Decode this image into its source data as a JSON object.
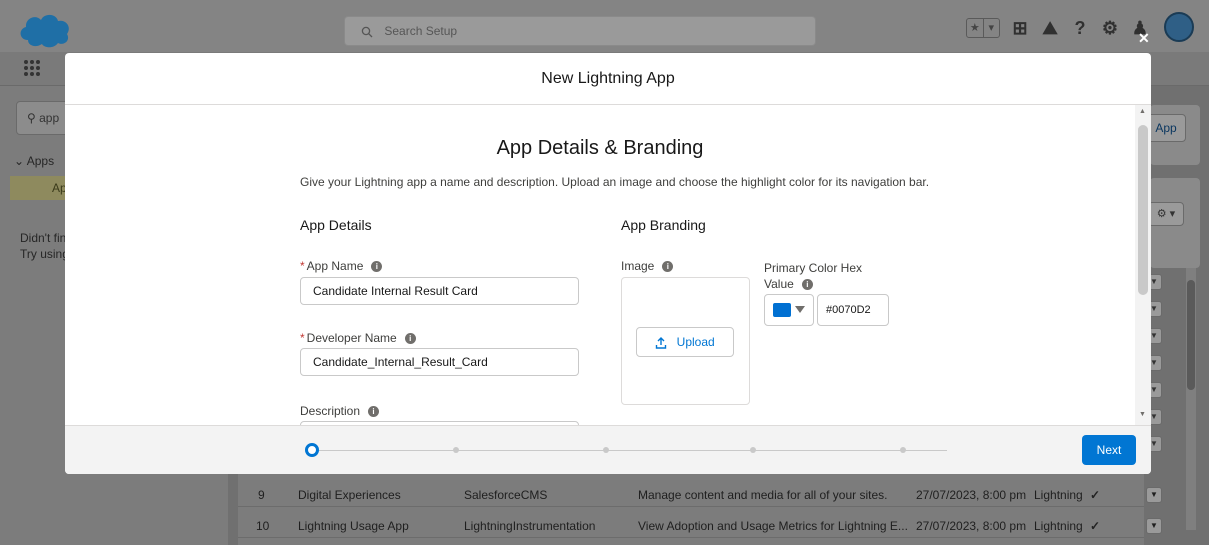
{
  "background": {
    "search": {
      "placeholder": "Search Setup"
    },
    "sidebar": {
      "search_value": "app",
      "apps_label": "Apps",
      "selected_item": "Ap",
      "help_line1": "Didn't fin",
      "help_line2": "Try using"
    },
    "right_button_label": "App",
    "table_rows": [
      {
        "num": "9",
        "label": "Digital Experiences",
        "developer_name": "SalesforceCMS",
        "description": "Manage content and media for all of your sites.",
        "modified": "27/07/2023, 8:00 pm",
        "type": "Lightning"
      },
      {
        "num": "10",
        "label": "Lightning Usage App",
        "developer_name": "LightningInstrumentation",
        "description": "View Adoption and Usage Metrics for Lightning E...",
        "modified": "27/07/2023, 8:00 pm",
        "type": "Lightning"
      }
    ]
  },
  "modal": {
    "title": "New Lightning App",
    "section_title": "App Details & Branding",
    "section_description": "Give your Lightning app a name and description. Upload an image and choose the highlight color for its navigation bar.",
    "app_details": {
      "heading": "App Details",
      "app_name_label": "App Name",
      "app_name_value": "Candidate Internal Result Card",
      "developer_name_label": "Developer Name",
      "developer_name_value": "Candidate_Internal_Result_Card",
      "description_label": "Description"
    },
    "app_branding": {
      "heading": "App Branding",
      "image_label": "Image",
      "upload_label": "Upload",
      "primary_color_label_line1": "Primary Color Hex",
      "primary_color_label_line2": "Value",
      "primary_color_value": "#0070D2"
    },
    "footer": {
      "next_label": "Next",
      "steps_total": 5,
      "active_step": 1
    }
  },
  "colors": {
    "brand_blue": "#0176d3",
    "primary_swatch": "#0070D2",
    "required_red": "#c23934"
  }
}
